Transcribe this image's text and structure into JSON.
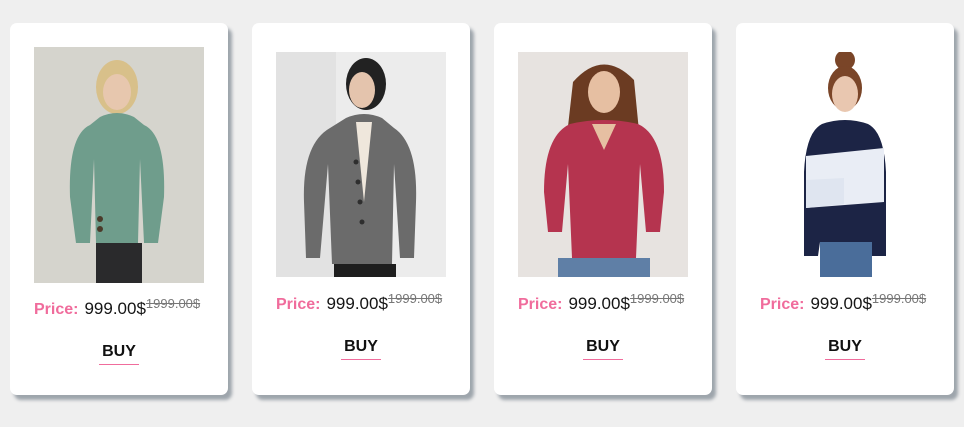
{
  "products": [
    {
      "image": "woman in green turtleneck sweater",
      "price_label": "Price:",
      "price": "999.00$",
      "old_price": "1999.00$",
      "button": "BUY",
      "colors": {
        "background": "#d9d7d2",
        "garment": "#6f9d8c",
        "pants": "#2a2a2c",
        "hair": "#d8c08a"
      }
    },
    {
      "image": "woman in grey cable-knit cardigan",
      "price_label": "Price:",
      "price": "999.00$",
      "old_price": "1999.00$",
      "button": "BUY",
      "colors": {
        "background": "#ececec",
        "garment": "#6b6b6b",
        "pants": "#1e1e1e",
        "hair": "#222222"
      }
    },
    {
      "image": "woman in magenta v-neck sweater",
      "price_label": "Price:",
      "price": "999.00$",
      "old_price": "1999.00$",
      "button": "BUY",
      "colors": {
        "background": "#e7e3e0",
        "garment": "#b5344f",
        "pants": "#5f7fa6",
        "hair": "#6b3b22"
      }
    },
    {
      "image": "woman in navy and white striped top",
      "price_label": "Price:",
      "price": "999.00$",
      "old_price": "1999.00$",
      "button": "BUY",
      "colors": {
        "background": "#ffffff",
        "garment": "#1c2445",
        "stripe": "#e9edf5",
        "pants": "#4a6d9a",
        "hair": "#7a4528"
      }
    }
  ]
}
